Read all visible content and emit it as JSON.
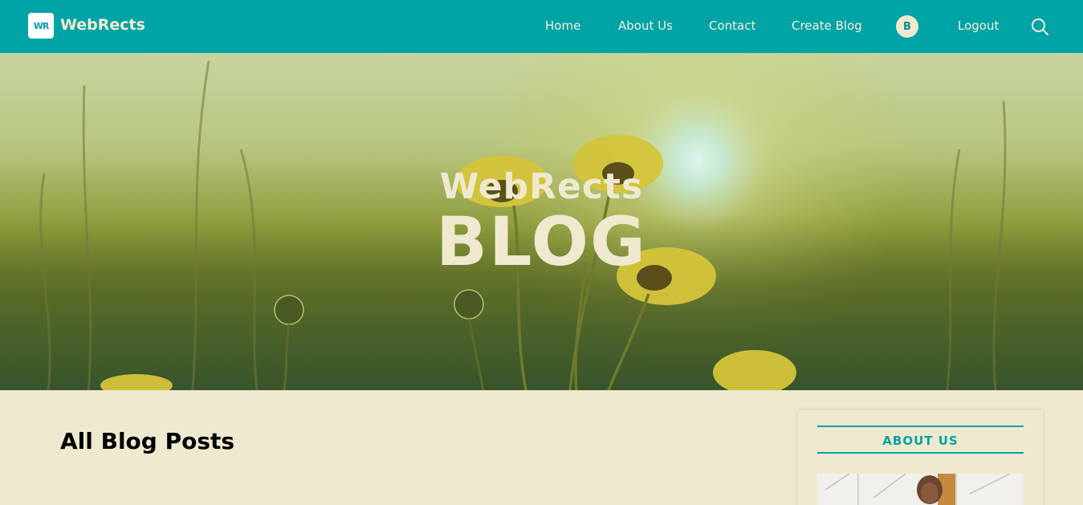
{
  "navbar": {
    "logo_mark": "WR",
    "brand": "WebRects",
    "links": {
      "home": "Home",
      "about": "About Us",
      "contact": "Contact",
      "create_blog": "Create Blog",
      "logout": "Logout"
    },
    "avatar_initial": "B",
    "icons": {
      "search": "search-icon"
    }
  },
  "hero": {
    "subtitle": "WebRects",
    "title": "BLOG"
  },
  "main": {
    "heading": "All Blog Posts"
  },
  "sidebar": {
    "title": "ABOUT US"
  },
  "colors": {
    "primary": "#00a3a6",
    "background": "#efe9cf",
    "hero_text": "#efe9cf"
  }
}
